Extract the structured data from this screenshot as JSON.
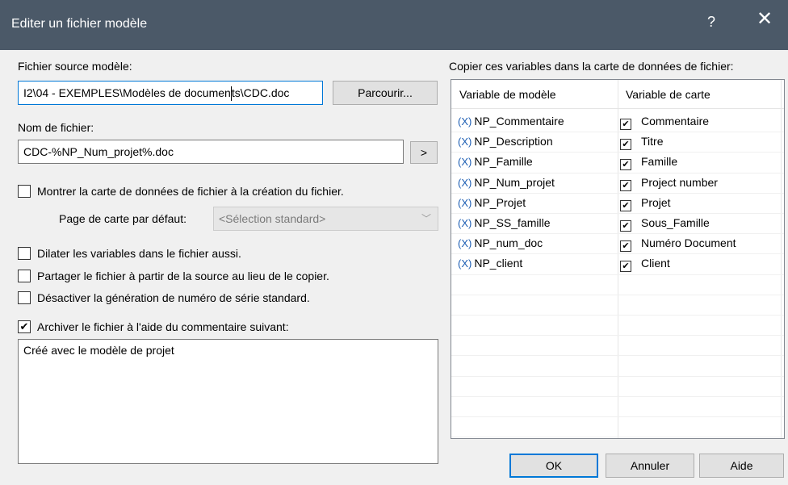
{
  "dialog": {
    "title": "Editer un fichier modèle",
    "help_glyph": "?",
    "close_glyph": "✕"
  },
  "source": {
    "label": "Fichier source modèle:",
    "value_before_caret": "I2\\04 - EXEMPLES\\Modèles de documen",
    "value_after_caret": "ts\\CDC.doc",
    "browse_label": "Parcourir..."
  },
  "filename": {
    "label": "Nom de fichier:",
    "value": "CDC-%NP_Num_projet%.doc",
    "insert_label": ">"
  },
  "options": {
    "show_card": {
      "label": "Montrer la carte de données de fichier à la création du fichier.",
      "checked": false
    },
    "default_page_label": "Page de carte par défaut:",
    "default_page_value": "<Sélection standard>",
    "expand_vars": {
      "label": "Dilater les variables dans le fichier aussi.",
      "checked": false
    },
    "share_file": {
      "label": "Partager le fichier à partir de la source au lieu de le copier.",
      "checked": false
    },
    "disable_serial": {
      "label": "Désactiver la génération de numéro de série standard.",
      "checked": false
    },
    "archive": {
      "label": "Archiver le fichier à l'aide du commentaire suivant:",
      "checked": true
    },
    "comment": "Créé avec le modèle de projet"
  },
  "mapping": {
    "label": "Copier ces variables dans la carte de données de fichier:",
    "col_template": "Variable de modèle",
    "col_card": "Variable de carte",
    "var_glyph": "(X)",
    "check_glyph": "✔",
    "rows": [
      {
        "template": "NP_Commentaire",
        "card": "Commentaire"
      },
      {
        "template": "NP_Description",
        "card": "Titre"
      },
      {
        "template": "NP_Famille",
        "card": "Famille"
      },
      {
        "template": "NP_Num_projet",
        "card": "Project number"
      },
      {
        "template": "NP_Projet",
        "card": "Projet"
      },
      {
        "template": "NP_SS_famille",
        "card": "Sous_Famille"
      },
      {
        "template": "NP_num_doc",
        "card": "Numéro Document"
      },
      {
        "template": "NP_client",
        "card": "Client"
      }
    ]
  },
  "buttons": {
    "ok": "OK",
    "cancel": "Annuler",
    "help": "Aide"
  }
}
